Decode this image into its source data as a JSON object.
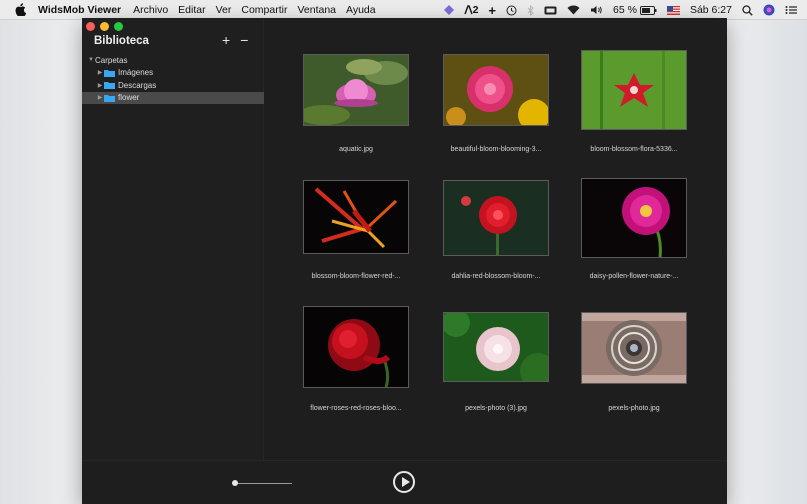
{
  "menubar": {
    "app_name": "WidsMob Viewer",
    "menus": [
      "Archivo",
      "Editar",
      "Ver",
      "Compartir",
      "Ventana",
      "Ayuda"
    ],
    "status": {
      "extension_count": "2",
      "battery_percent": "65 %",
      "clock": "Sáb 6:27"
    }
  },
  "sidebar": {
    "title": "Biblioteca",
    "add_label": "+",
    "remove_label": "−",
    "tree": {
      "root_label": "Carpetas",
      "children": [
        {
          "label": "Imágenes"
        },
        {
          "label": "Descargas"
        },
        {
          "label": "flower"
        }
      ]
    }
  },
  "gallery": {
    "items": [
      {
        "caption": "aquatic.jpg"
      },
      {
        "caption": "beautiful-bloom-blooming-3..."
      },
      {
        "caption": "bloom-blossom-flora-5336..."
      },
      {
        "caption": "blossom-bloom-flower-red-..."
      },
      {
        "caption": "dahlia-red-blossom-bloom-..."
      },
      {
        "caption": "daisy-pollen-flower-nature-..."
      },
      {
        "caption": "flower-roses-red-roses-bloo..."
      },
      {
        "caption": "pexels-photo (3).jpg"
      },
      {
        "caption": "pexels-photo.jpg"
      }
    ]
  },
  "colors": {
    "window_bg": "#1e1e1e",
    "selection": "#4a4a4c",
    "folder_blue": "#3aa7f2",
    "menubar_bg": "#ececec"
  },
  "bottombar": {
    "slider_level": 0.05
  }
}
